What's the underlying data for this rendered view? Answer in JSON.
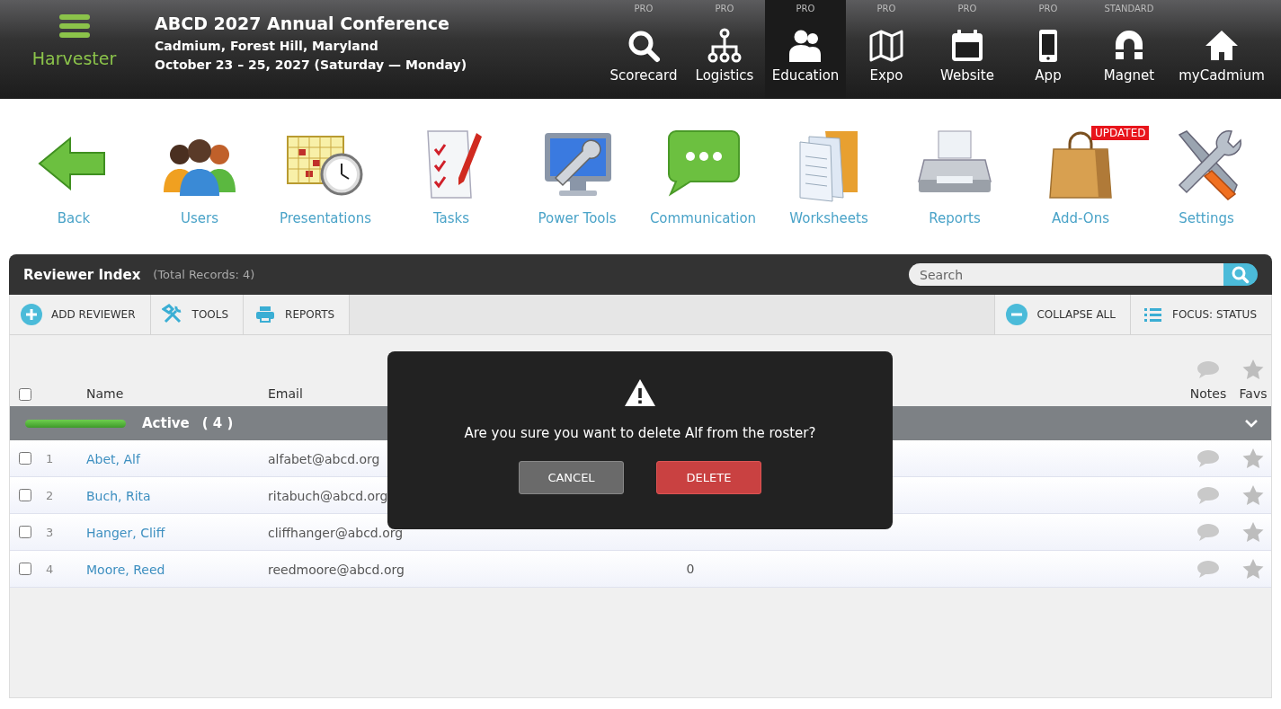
{
  "brand": {
    "label": "Harvester"
  },
  "event": {
    "title": "ABCD 2027 Annual Conference",
    "location": "Cadmium, Forest Hill, Maryland",
    "dates": "October 23 – 25, 2027 (Saturday — Monday)"
  },
  "nav": [
    {
      "tier": "PRO",
      "label": "Scorecard",
      "kind": "search",
      "selected": false
    },
    {
      "tier": "PRO",
      "label": "Logistics",
      "kind": "hierarchy",
      "selected": false
    },
    {
      "tier": "PRO",
      "label": "Education",
      "kind": "people",
      "selected": true
    },
    {
      "tier": "PRO",
      "label": "Expo",
      "kind": "map",
      "selected": false
    },
    {
      "tier": "PRO",
      "label": "Website",
      "kind": "calendar",
      "selected": false
    },
    {
      "tier": "PRO",
      "label": "App",
      "kind": "phone",
      "selected": false
    },
    {
      "tier": "STANDARD",
      "label": "Magnet",
      "kind": "magnet",
      "selected": false
    },
    {
      "label": "myCadmium",
      "kind": "home",
      "selected": false
    }
  ],
  "apps": [
    {
      "label": "Back",
      "kind": "back"
    },
    {
      "label": "Users",
      "kind": "users"
    },
    {
      "label": "Presentations",
      "kind": "presentations"
    },
    {
      "label": "Tasks",
      "kind": "tasks"
    },
    {
      "label": "Power Tools",
      "kind": "powertools"
    },
    {
      "label": "Communication",
      "kind": "communication"
    },
    {
      "label": "Worksheets",
      "kind": "worksheets"
    },
    {
      "label": "Reports",
      "kind": "reports"
    },
    {
      "label": "Add-Ons",
      "kind": "addons",
      "badge": "UPDATED"
    },
    {
      "label": "Settings",
      "kind": "settings"
    }
  ],
  "panel": {
    "title": "Reviewer Index",
    "total": "(Total Records: 4)",
    "search": {
      "placeholder": "Search"
    },
    "toolbar_left": [
      {
        "label": "ADD REVIEWER",
        "kind": "add"
      },
      {
        "label": "TOOLS",
        "kind": "tools"
      },
      {
        "label": "REPORTS",
        "kind": "print"
      }
    ],
    "toolbar_right": [
      {
        "label": "COLLAPSE ALL",
        "kind": "collapse"
      },
      {
        "label": "FOCUS: STATUS",
        "kind": "list"
      }
    ],
    "select_all": {
      "checked": false
    },
    "columns": {
      "name": "Name",
      "email": "Email",
      "notes": "Notes",
      "favs": "Favs"
    },
    "group": {
      "label": "Active",
      "count": "( 4 )",
      "expanded": true
    },
    "rows": [
      {
        "checked": false,
        "number": "1",
        "name": "Abet, Alf",
        "email": "alfabet@abcd.org",
        "favorite": false
      },
      {
        "checked": false,
        "number": "2",
        "name": "Buch, Rita",
        "email": "ritabuch@abcd.org",
        "favorite": false
      },
      {
        "checked": false,
        "number": "3",
        "name": "Hanger, Cliff",
        "email": "cliffhanger@abcd.org",
        "favorite": false
      },
      {
        "checked": false,
        "number": "4",
        "name": "Moore, Reed",
        "email": "reedmoore@abcd.org",
        "column_3": "0",
        "favorite": false
      }
    ]
  },
  "dialog": {
    "message": "Are you sure you want to delete Alf from the roster?",
    "buttons": [
      {
        "label": "CANCEL",
        "kind": "cancel"
      },
      {
        "label": "DELETE",
        "kind": "delete"
      }
    ]
  }
}
